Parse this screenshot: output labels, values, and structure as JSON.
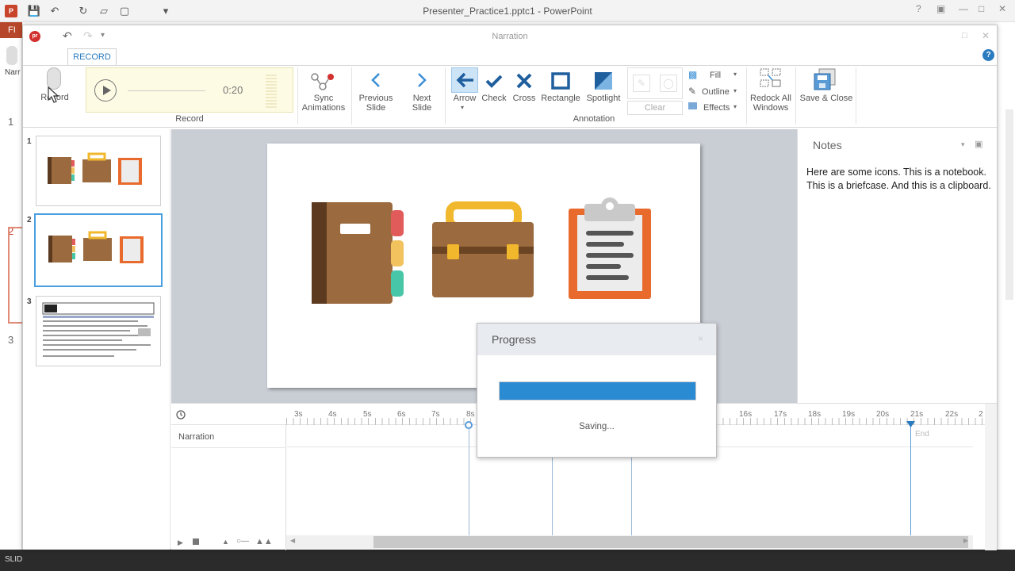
{
  "app": {
    "window_title": "Presenter_Practice1.pptc1 - PowerPoint",
    "file_tab": "FI",
    "left_slide_numbers": [
      "1",
      "2",
      "3"
    ],
    "left_narr_label": "Narr",
    "status_label": "SLID"
  },
  "narration_window": {
    "title": "Narration",
    "logo": "pr",
    "tabs": [
      {
        "label": "RECORD",
        "active": true
      }
    ],
    "ribbon": {
      "record_button": "Record",
      "player_time": "0:20",
      "record_group": "Record",
      "sync_animations": "Sync Animations",
      "previous_slide": "Previous Slide",
      "next_slide": "Next Slide",
      "arrow": "Arrow",
      "check": "Check",
      "cross": "Cross",
      "rectangle": "Rectangle",
      "spotlight": "Spotlight",
      "annotation_group": "Annotation",
      "clear": "Clear",
      "fill": "Fill",
      "outline": "Outline",
      "effects": "Effects",
      "redock_all_windows": "Redock All Windows",
      "save_close": "Save & Close"
    },
    "thumbnails": [
      {
        "number": "1",
        "selected": false
      },
      {
        "number": "2",
        "selected": true
      },
      {
        "number": "3",
        "selected": false
      }
    ],
    "notes": {
      "title": "Notes",
      "text": "Here are some icons. This is a notebook. This is a briefcase. And this is a clipboard."
    },
    "timeline": {
      "ticks": [
        "3s",
        "4s",
        "5s",
        "6s",
        "7s",
        "8s",
        "16s",
        "17s",
        "18s",
        "19s",
        "20s",
        "21s",
        "22s",
        "2"
      ],
      "track_label": "Narration",
      "end_marker": "End"
    }
  },
  "progress_dialog": {
    "title": "Progress",
    "status": "Saving...",
    "progress_fraction": 1.0,
    "close_glyph": "×"
  },
  "colors": {
    "accent_blue": "#2a8ad2",
    "powerpoint_red": "#b7472a",
    "player_bg": "#fdfbe3"
  }
}
